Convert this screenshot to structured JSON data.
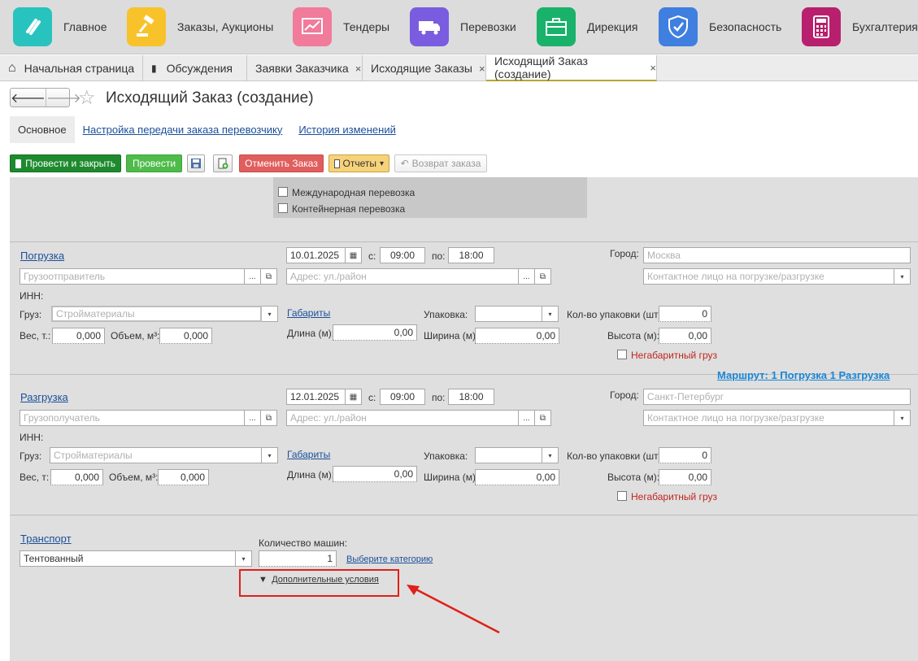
{
  "sections": [
    {
      "label": "Главное",
      "icon": "chain-link-icon",
      "color": "#28c3bf"
    },
    {
      "label": "Заказы, Аукционы",
      "icon": "gavel-icon",
      "color": "#f8c22a"
    },
    {
      "label": "Тендеры",
      "icon": "chart-board-icon",
      "color": "#f07b9b"
    },
    {
      "label": "Перевозки",
      "icon": "truck-icon",
      "color": "#7a5ce0"
    },
    {
      "label": "Дирекция",
      "icon": "briefcase-icon",
      "color": "#19b26b"
    },
    {
      "label": "Безопасность",
      "icon": "shield-check-icon",
      "color": "#3f7fe0"
    },
    {
      "label": "Бухгалтерия",
      "icon": "calculator-icon",
      "color": "#b8206d"
    }
  ],
  "tabs": [
    {
      "label": "Начальная страница"
    },
    {
      "label": "Обсуждения"
    },
    {
      "label": "Заявки Заказчика",
      "close": "×"
    },
    {
      "label": "Исходящие Заказы",
      "close": "×"
    },
    {
      "label": "Исходящий Заказ (создание)",
      "close": "×",
      "active": true
    }
  ],
  "nav": {
    "back": "🡐",
    "forward": "🡒",
    "star": "☆"
  },
  "page_title": "Исходящий Заказ (создание)",
  "subtabs": [
    "Основное",
    "Настройка передачи заказа перевозчику",
    "История изменений"
  ],
  "toolbar": {
    "post_close": "Провести и закрыть",
    "post": "Провести",
    "cancel_order": "Отменить Заказ",
    "reports": "Отчеты",
    "return_order": "Возврат заказа"
  },
  "checks": {
    "international": "Международная перевозка",
    "container": "Контейнерная перевозка"
  },
  "loading": {
    "title": "Погрузка",
    "date": "10.01.2025",
    "from_label": "с:",
    "from_time": "09:00",
    "to_label": "по:",
    "to_time": "18:00",
    "city_label": "Город:",
    "city": "Москва",
    "party_ph": "Грузоотправитель",
    "address_ph": "Адрес: ул./район",
    "contact_ph": "Контактное лицо на погрузке/разгрузке",
    "inn_label": "ИНН:",
    "cargo_label": "Груз:",
    "cargo": "Стройматериалы",
    "dims_link": "Габариты",
    "pack_label": "Упаковка:",
    "pack_count_label": "Кол-во упаковки (шт):",
    "pack_count": "0",
    "weight_label": "Вес, т.:",
    "weight": "0,000",
    "volume_label": "Объем, м³:",
    "volume": "0,000",
    "length_label": "Длина (м):",
    "length": "0,00",
    "width_label": "Ширина (м):",
    "width": "0,00",
    "height_label": "Высота (м):",
    "height": "0,00",
    "oversize": "Негабаритный груз"
  },
  "route": "Маршрут:  1 Погрузка  1 Разгрузка",
  "unloading": {
    "title": "Разгрузка",
    "date": "12.01.2025",
    "from_label": "с:",
    "from_time": "09:00",
    "to_label": "по:",
    "to_time": "18:00",
    "city_label": "Город:",
    "city": "Санкт-Петербург",
    "party_ph": "Грузополучатель",
    "address_ph": "Адрес: ул./район",
    "contact_ph": "Контактное лицо на погрузке/разгрузке",
    "inn_label": "ИНН:",
    "cargo_label": "Груз:",
    "cargo": "Стройматериалы",
    "dims_link": "Габариты",
    "pack_label": "Упаковка:",
    "pack_count_label": "Кол-во упаковки (шт):",
    "pack_count": "0",
    "weight_label": "Вес, т:",
    "weight": "0,000",
    "volume_label": "Объем, м³:",
    "volume": "0,000",
    "length_label": "Длина (м):",
    "length": "0,00",
    "width_label": "Ширина (м):",
    "width": "0,00",
    "height_label": "Высота (м):",
    "height": "0,00",
    "oversize": "Негабаритный груз"
  },
  "transport": {
    "title": "Транспорт",
    "type": "Тентованный",
    "count_label": "Количество машин:",
    "count": "1",
    "category_link": "Выберите категорию",
    "extra_link": "Дополнительные условия",
    "extra_arrow": "▼"
  },
  "icons": {
    "dropdown": "▾",
    "ellipsis": "...",
    "open": "⧉",
    "calendar": "▦",
    "home": "⌂",
    "chat": "▮"
  }
}
